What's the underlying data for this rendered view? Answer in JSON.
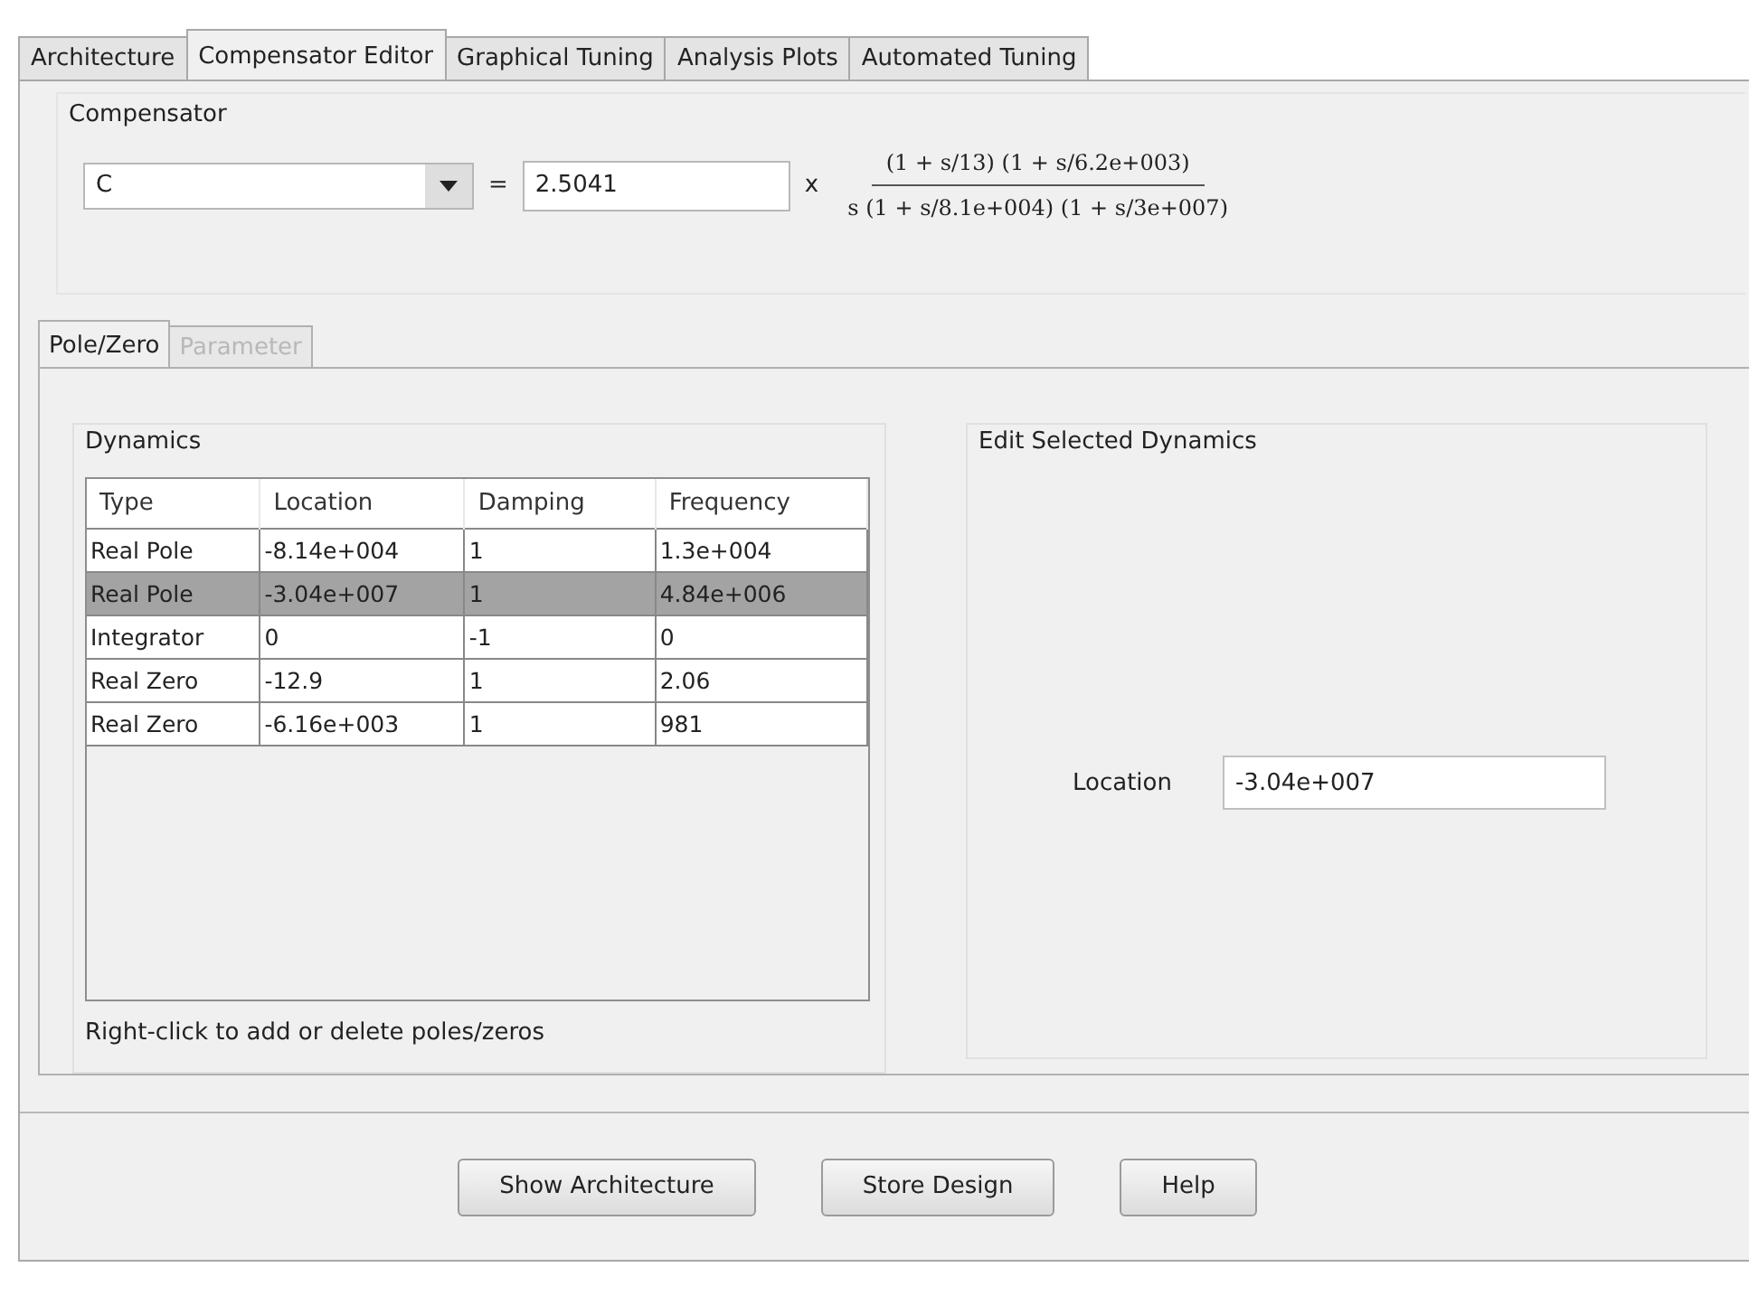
{
  "tabs": [
    {
      "label": "Architecture",
      "selected": false
    },
    {
      "label": "Compensator Editor",
      "selected": true
    },
    {
      "label": "Graphical Tuning",
      "selected": false
    },
    {
      "label": "Analysis Plots",
      "selected": false
    },
    {
      "label": "Automated Tuning",
      "selected": false
    }
  ],
  "compensator": {
    "title": "Compensator",
    "name_dropdown": "C",
    "equals": "=",
    "gain": "2.5041",
    "times": "x",
    "numerator": "(1 + s/13) (1 + s/6.2e+003)",
    "denominator": "s (1 + s/8.1e+004) (1 + s/3e+007)"
  },
  "subtabs": [
    {
      "label": "Pole/Zero",
      "selected": true,
      "disabled": false
    },
    {
      "label": "Parameter",
      "selected": false,
      "disabled": true
    }
  ],
  "dynamics": {
    "title": "Dynamics",
    "columns": [
      "Type",
      "Location",
      "Damping",
      "Frequency"
    ],
    "rows": [
      {
        "cells": [
          "Real Pole",
          "-8.14e+004",
          "1",
          "1.3e+004"
        ],
        "selected": false
      },
      {
        "cells": [
          "Real Pole",
          "-3.04e+007",
          "1",
          "4.84e+006"
        ],
        "selected": true
      },
      {
        "cells": [
          "Integrator",
          "0",
          "-1",
          "0"
        ],
        "selected": false
      },
      {
        "cells": [
          "Real Zero",
          "-12.9",
          "1",
          "2.06"
        ],
        "selected": false
      },
      {
        "cells": [
          "Real Zero",
          "-6.16e+003",
          "1",
          "981"
        ],
        "selected": false
      }
    ],
    "hint": "Right-click to add or delete poles/zeros"
  },
  "edit_selected": {
    "title": "Edit Selected Dynamics",
    "label": "Location",
    "value": "-3.04e+007"
  },
  "buttons": [
    "Show Architecture",
    "Store Design",
    "Help"
  ]
}
